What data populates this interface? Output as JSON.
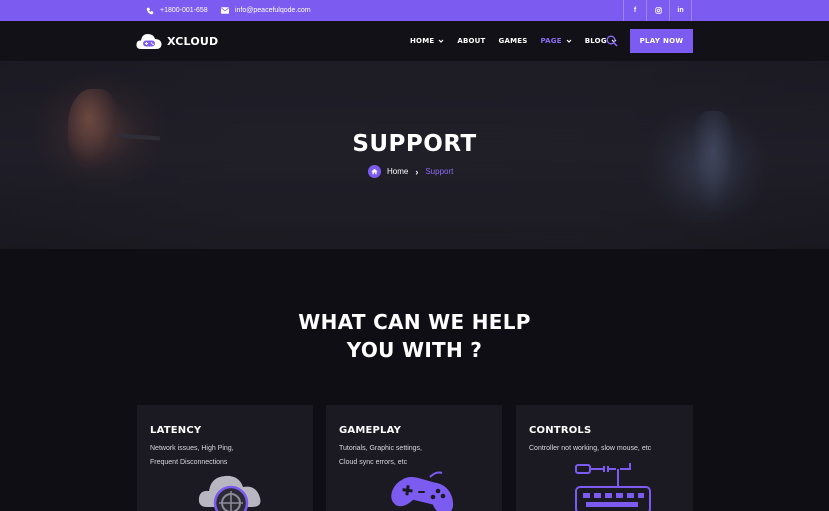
{
  "topbar": {
    "phone": "+1800-001-658",
    "email": "info@peacefulqode.com",
    "socials": [
      "f",
      "◎",
      "in"
    ]
  },
  "header": {
    "logo_text": "XCLOUD",
    "nav": [
      {
        "label": "HOME",
        "has_dropdown": true,
        "active": false
      },
      {
        "label": "ABOUT",
        "has_dropdown": false,
        "active": false
      },
      {
        "label": "GAMES",
        "has_dropdown": false,
        "active": false
      },
      {
        "label": "PAGE",
        "has_dropdown": true,
        "active": true
      },
      {
        "label": "BLOG",
        "has_dropdown": true,
        "active": false
      }
    ],
    "cta_label": "PLAY NOW"
  },
  "hero": {
    "title": "SUPPORT",
    "breadcrumb": {
      "home": "Home",
      "separator": "›",
      "current": "Support"
    }
  },
  "help": {
    "title_line1": "WHAT CAN WE HELP",
    "title_line2": "YOU WITH ?",
    "cards": [
      {
        "title": "LATENCY",
        "desc_line1": "Network issues, High Ping,",
        "desc_line2": "Frequent Disconnections",
        "icon": "cloud-server-icon"
      },
      {
        "title": "GAMEPLAY",
        "desc_line1": "Tutorials, Graphic settings,",
        "desc_line2": "Cloud sync errors, etc",
        "icon": "gamepad-icon"
      },
      {
        "title": "CONTROLS",
        "desc_line1": "Controller not working, slow mouse, etc",
        "desc_line2": "",
        "icon": "keyboard-plug-icon"
      }
    ]
  },
  "colors": {
    "accent": "#7c5cf0",
    "background": "#0f0e14",
    "card": "#1b1a22"
  }
}
